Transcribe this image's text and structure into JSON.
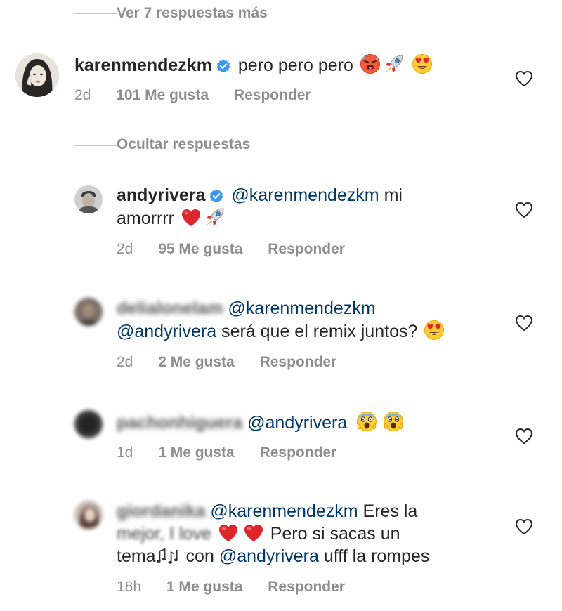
{
  "top_toggle": {
    "label": "Ver 7 respuestas más"
  },
  "main_comment": {
    "username": "karenmendezkm",
    "text": "pero pero pero",
    "emojis": [
      "hot-face",
      "rocket",
      "heart-eyes"
    ],
    "time": "2d",
    "likes": "101 Me gusta",
    "reply": "Responder"
  },
  "replies_toggle": {
    "label": "Ocultar respuestas"
  },
  "replies": [
    {
      "username": "andyrivera",
      "verified": true,
      "mention": "@karenmendezkm",
      "line1_rest": "mi",
      "line2": "amorrrr",
      "emojis": [
        "red-heart",
        "rocket"
      ],
      "time": "2d",
      "likes": "95 Me gusta",
      "reply": "Responder"
    },
    {
      "username": "delialonelam",
      "mention": "@karenmendezkm",
      "mention2": "@andyrivera",
      "text": "será que el remix juntos?",
      "emojis": [
        "heart-eyes"
      ],
      "time": "2d",
      "likes": "2 Me gusta",
      "reply": "Responder"
    },
    {
      "username": "pachonhiguera",
      "mention": "@andyrivera",
      "emojis": [
        "screaming-face",
        "screaming-face"
      ],
      "time": "1d",
      "likes": "1 Me gusta",
      "reply": "Responder"
    },
    {
      "username": "giordanika",
      "mention": "@karenmendezkm",
      "text1": "Eres la",
      "blurred_text": "mejor, I love",
      "text2": "Pero si sacas un",
      "text3": "tema",
      "text4": "con",
      "mention2": "@andyrivera",
      "text5": "ufff la rompes",
      "emojis": [
        "red-heart",
        "red-heart",
        "musical-notes"
      ],
      "time": "18h",
      "likes": "1 Me gusta",
      "reply": "Responder"
    }
  ],
  "colors": {
    "text": "#262626",
    "secondary": "#8e8e8e",
    "mention": "#00376b",
    "verified": "#3897f0",
    "divider": "#c7c7c7"
  }
}
